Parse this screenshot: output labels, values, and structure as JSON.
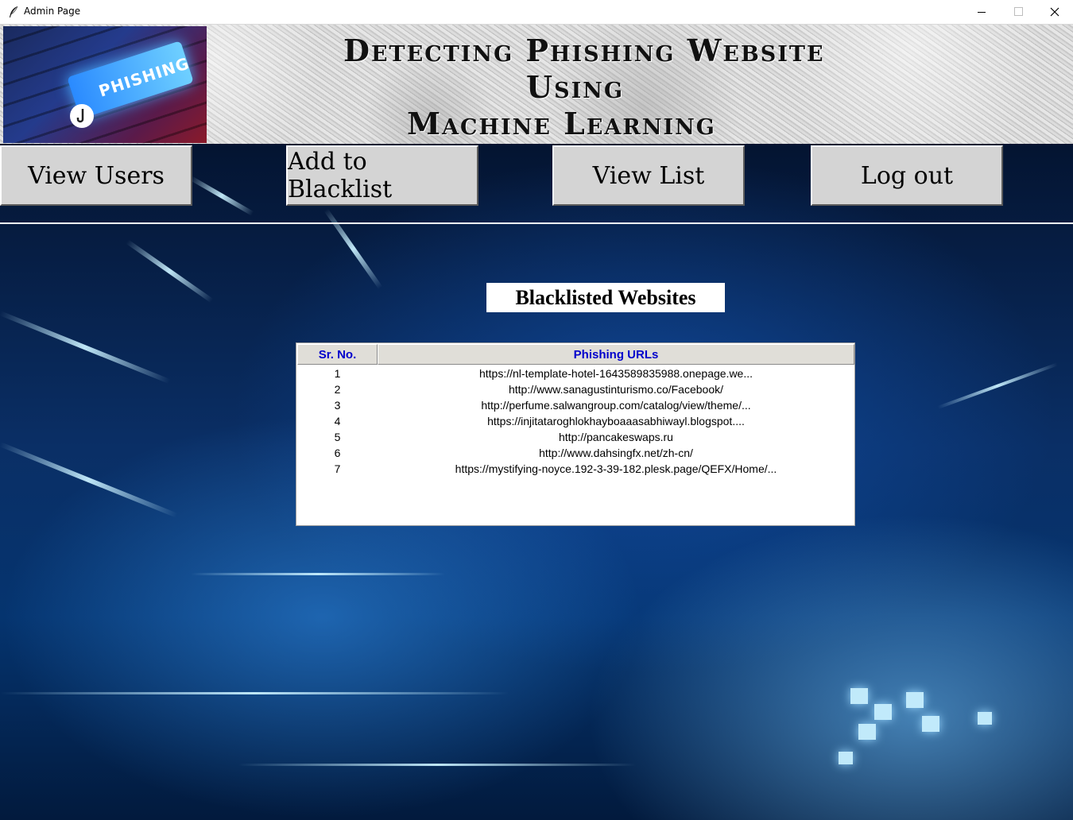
{
  "window": {
    "title": "Admin Page",
    "controls": [
      "minimize",
      "maximize",
      "close"
    ]
  },
  "header": {
    "title_lines": [
      "Detecting Phishing Website",
      "Using",
      "Machine Learning"
    ],
    "logo_text": "PHISHING"
  },
  "nav": {
    "view_users": "View Users",
    "add_blacklist": "Add to Blacklist",
    "view_list": "View List",
    "logout": "Log out"
  },
  "main": {
    "heading": "Blacklisted Websites",
    "table": {
      "columns": [
        "Sr. No.",
        "Phishing URLs"
      ],
      "header_color": "#0000cc",
      "rows": [
        [
          "1",
          "https://nl-template-hotel-1643589835988.onepage.we..."
        ],
        [
          "2",
          "http://www.sanagustinturismo.co/Facebook/"
        ],
        [
          "3",
          "http://perfume.salwangroup.com/catalog/view/theme/..."
        ],
        [
          "4",
          "https://injitataroghlokhayboaaasabhiwayl.blogspot...."
        ],
        [
          "5",
          "http://pancakeswaps.ru"
        ],
        [
          "6",
          "http://www.dahsingfx.net/zh-cn/"
        ],
        [
          "7",
          "https://mystifying-noyce.192-3-39-182.plesk.page/QEFX/Home/..."
        ]
      ]
    }
  }
}
